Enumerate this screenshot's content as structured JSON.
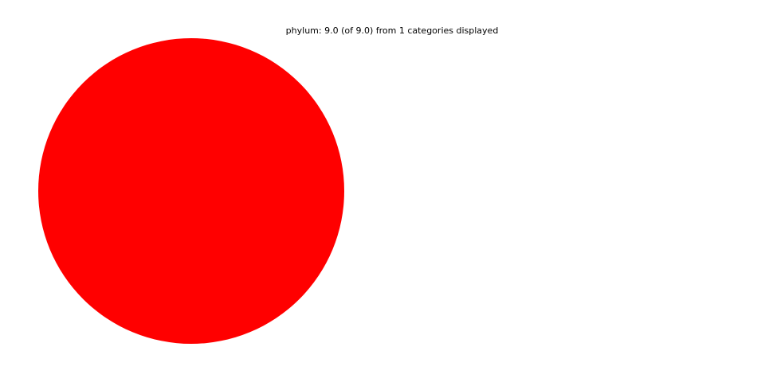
{
  "chart_data": {
    "type": "pie",
    "title": "phylum: 9.0 (of 9.0) from 1 categories displayed",
    "slices": [
      {
        "value": 9.0,
        "color": "#ff0000"
      }
    ],
    "total": 9.0,
    "legend": "none"
  }
}
